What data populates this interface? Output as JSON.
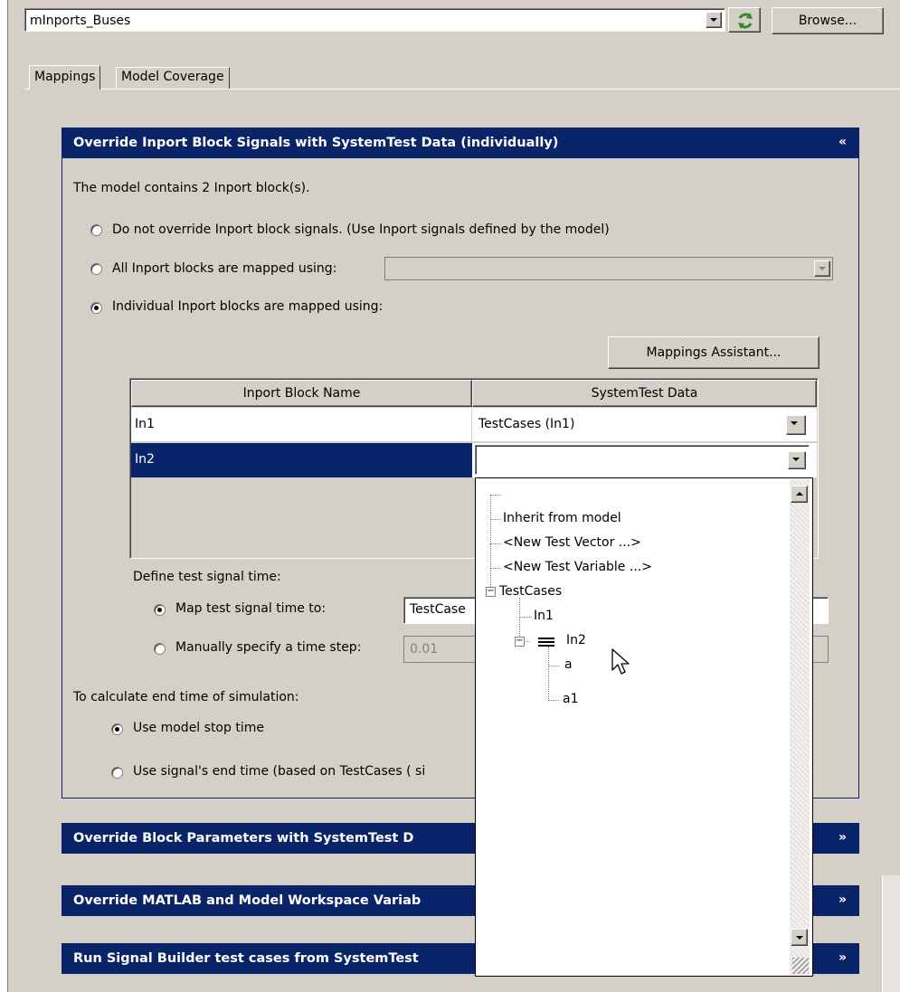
{
  "toolbar": {
    "model_value": "mInports_Buses",
    "browse_label": "Browse..."
  },
  "tabs": [
    {
      "label": "Mappings",
      "active": true
    },
    {
      "label": "Model Coverage",
      "active": false
    }
  ],
  "inport_section": {
    "title": "Override Inport Block Signals with SystemTest Data (individually)",
    "info": "The model contains 2 Inport block(s).",
    "options": [
      {
        "label": "Do not override Inport block signals. (Use Inport signals defined by the model)",
        "checked": false
      },
      {
        "label": "All Inport blocks are mapped using:",
        "checked": false
      },
      {
        "label": "Individual Inport blocks are mapped using:",
        "checked": true
      }
    ],
    "all_mapped_value": "",
    "mappings_assistant_label": "Mappings Assistant...",
    "grid": {
      "columns": [
        "Inport Block Name",
        "SystemTest Data"
      ],
      "rows": [
        {
          "name": "In1",
          "data": "TestCases (In1)",
          "selected": false
        },
        {
          "name": "In2",
          "data": "",
          "selected": true
        }
      ]
    },
    "time": {
      "heading": "Define test signal time:",
      "map_label": "Map test signal time to:",
      "map_value": "TestCase",
      "manual_label": "Manually specify a time step:",
      "manual_value": "0.01",
      "map_checked": true
    },
    "end_time": {
      "heading": "To calculate end time of simulation:",
      "use_model_stop": "Use model stop time",
      "use_signal_end": "Use signal's end time (based on TestCases ( si"
    }
  },
  "collapsed_sections": [
    {
      "title": "Override Block Parameters with SystemTest D"
    },
    {
      "title": "Override MATLAB and Model Workspace Variab"
    },
    {
      "title": "Run Signal Builder test cases from SystemTest"
    }
  ],
  "dropdown_tree": {
    "items": [
      {
        "label": "Inherit from model"
      },
      {
        "label": "<New Test Vector ...>"
      },
      {
        "label": "<New Test Variable ...>"
      },
      {
        "label": "TestCases",
        "expanded": true
      },
      {
        "label": "In1"
      },
      {
        "label": "In2",
        "expanded": true
      },
      {
        "label": "a"
      },
      {
        "label": "a1"
      }
    ]
  },
  "colors": {
    "header_bg": "#0a246a",
    "selection_bg": "#0a246a",
    "face": "#d4d0c8",
    "refresh_green": "#2e8b2e"
  }
}
